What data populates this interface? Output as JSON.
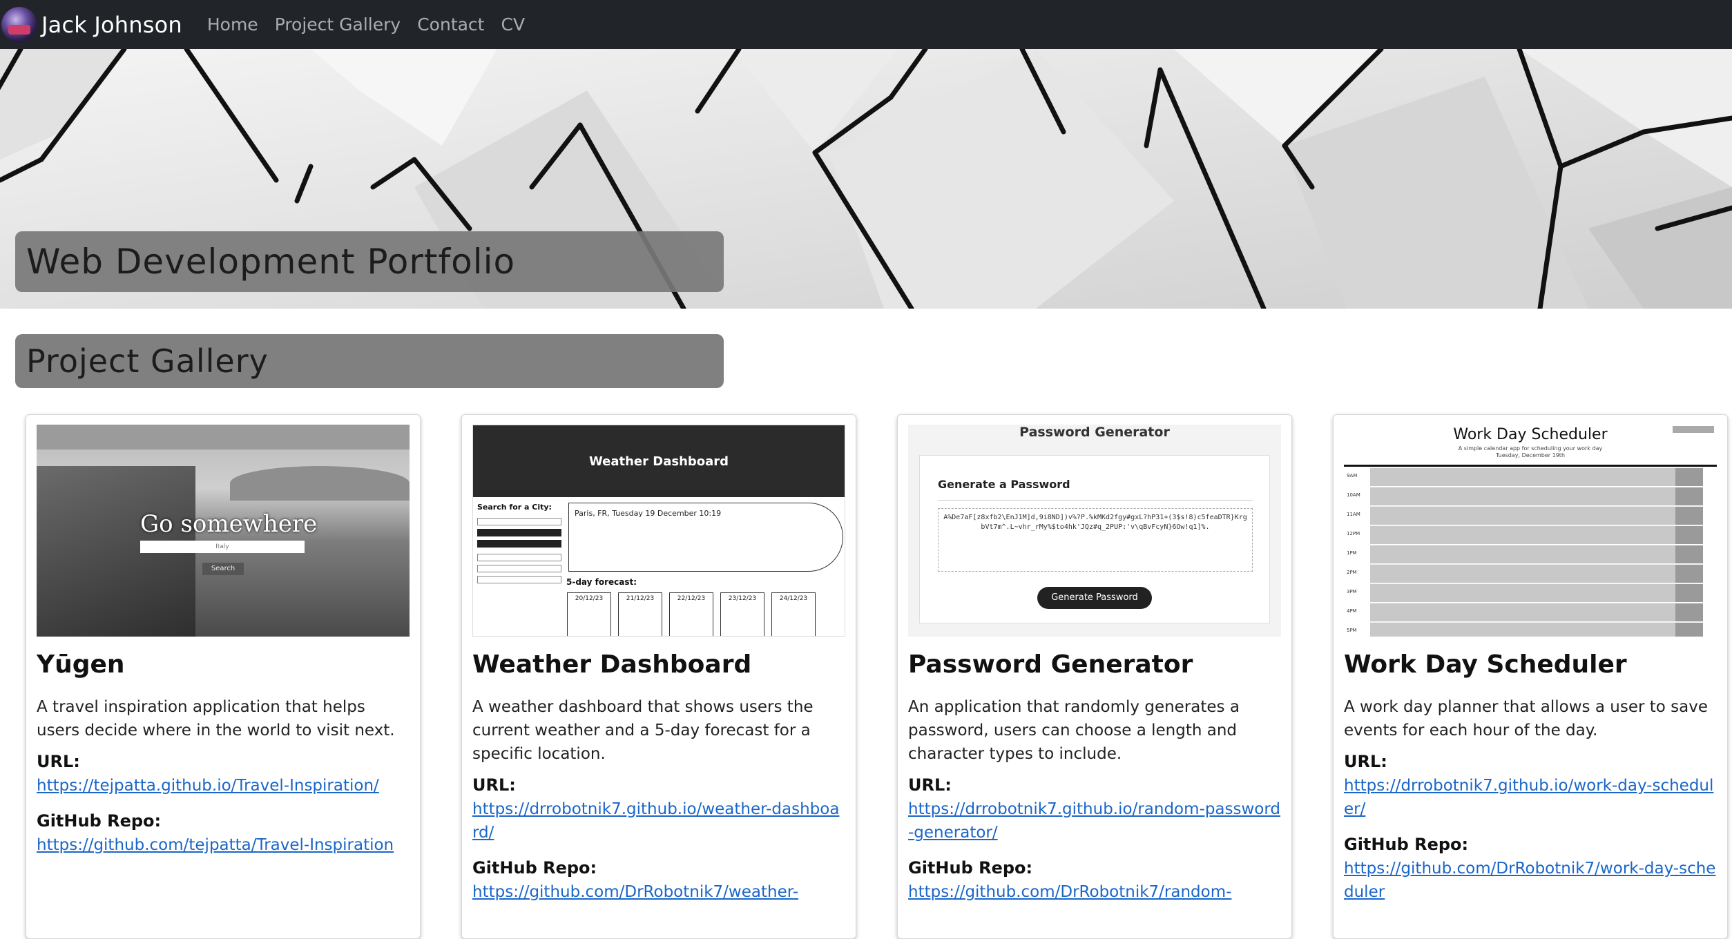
{
  "navbar": {
    "brand": "Jack Johnson",
    "links": [
      "Home",
      "Project Gallery",
      "Contact",
      "CV"
    ]
  },
  "hero": {
    "title": "Web Development Portfolio"
  },
  "gallery": {
    "title": "Project Gallery",
    "url_label": "URL:",
    "repo_label": "GitHub Repo:",
    "cards": [
      {
        "title": "Yūgen",
        "description": "A travel inspiration application that helps users decide where in the world to visit next.",
        "url": "https://tejpatta.github.io/Travel-Inspiration/",
        "repo": "https://github.com/tejpatta/Travel-Inspiration",
        "image": {
          "heading": "Go somewhere",
          "input_placeholder": "Italy",
          "button": "Search"
        }
      },
      {
        "title": "Weather Dashboard",
        "description": "A weather dashboard that shows users the current weather and a 5-day forecast for a specific location.",
        "url": "https://drrobotnik7.github.io/weather-dashboard/",
        "repo": "https://github.com/DrRobotnik7/weather-",
        "image": {
          "header": "Weather Dashboard",
          "search_label": "Search for a City:",
          "current": "Paris, FR, Tuesday 19 December 10:19",
          "forecast_label": "5-day forecast:",
          "days": [
            "20/12/23",
            "21/12/23",
            "22/12/23",
            "23/12/23",
            "24/12/23"
          ]
        }
      },
      {
        "title": "Password Generator",
        "description": "An application that randomly generates a password, users can choose a length and character types to include.",
        "url": "https://drrobotnik7.github.io/random-password-generator/",
        "repo": "https://github.com/DrRobotnik7/random-",
        "image": {
          "header": "Password Generator",
          "card_title": "Generate a Password",
          "password": "A%De7aF[z8xfb2\\EnJ1M]d,9i8ND])v%?P.%kMKd2fgy#gxL?hP31+(3$s!8)c5feaDTR}KrgbVt7m^.L~vhr_rMy%$to4hk'JQz#q_2PUP:'v\\qBvFcyN}6Ow!q1]%.",
          "button": "Generate Password"
        }
      },
      {
        "title": "Work Day Scheduler",
        "description": "A work day planner that allows a user to save events for each hour of the day.",
        "url": "https://drrobotnik7.github.io/work-day-scheduler/",
        "repo": "https://github.com/DrRobotnik7/work-day-scheduler",
        "image": {
          "header": "Work Day Scheduler",
          "subtitle": "A simple calendar app for scheduling your work day",
          "date": "Tuesday, December 19th",
          "hours": [
            "9AM",
            "10AM",
            "11AM",
            "12PM",
            "1PM",
            "2PM",
            "3PM",
            "4PM",
            "5PM"
          ]
        }
      }
    ]
  },
  "colors": {
    "navbar_bg": "#212529",
    "title_box": "#808080",
    "link": "#1a66c9"
  }
}
